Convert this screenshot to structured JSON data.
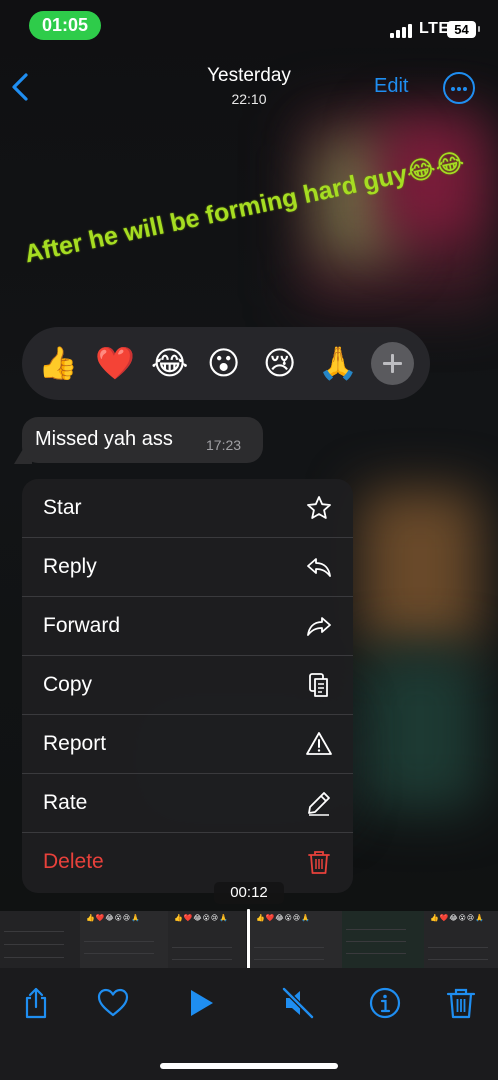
{
  "status_bar": {
    "time": "01:05",
    "network": "LTE",
    "battery": "54"
  },
  "header": {
    "title": "Yesterday",
    "subtitle": "22:10",
    "edit_label": "Edit",
    "back_icon": "chevron-left-icon",
    "more_icon": "ellipsis-circle-icon"
  },
  "video": {
    "caption": "After he will be forming hard guy😂😂"
  },
  "reactions": [
    "👍",
    "❤️",
    "😂",
    "😮",
    "😢",
    "🙏"
  ],
  "message": {
    "text": "Missed yah ass",
    "time": "17:23"
  },
  "context_menu": {
    "items": [
      {
        "label": "Star",
        "icon": "star-icon"
      },
      {
        "label": "Reply",
        "icon": "reply-icon"
      },
      {
        "label": "Forward",
        "icon": "forward-icon"
      },
      {
        "label": "Copy",
        "icon": "copy-icon"
      },
      {
        "label": "Report",
        "icon": "warning-icon"
      },
      {
        "label": "Rate",
        "icon": "pencil-icon"
      },
      {
        "label": "Delete",
        "icon": "trash-icon"
      }
    ]
  },
  "scrubber": {
    "current_time": "00:12"
  },
  "toolbar": {
    "icons": [
      "share-icon",
      "heart-icon",
      "play-icon",
      "mute-icon",
      "info-icon",
      "trash-icon"
    ]
  },
  "colors": {
    "accent": "#1f8ef1",
    "status_pill": "#2ecc4a",
    "caption": "#a6dd22",
    "destructive": "#e8413b"
  }
}
